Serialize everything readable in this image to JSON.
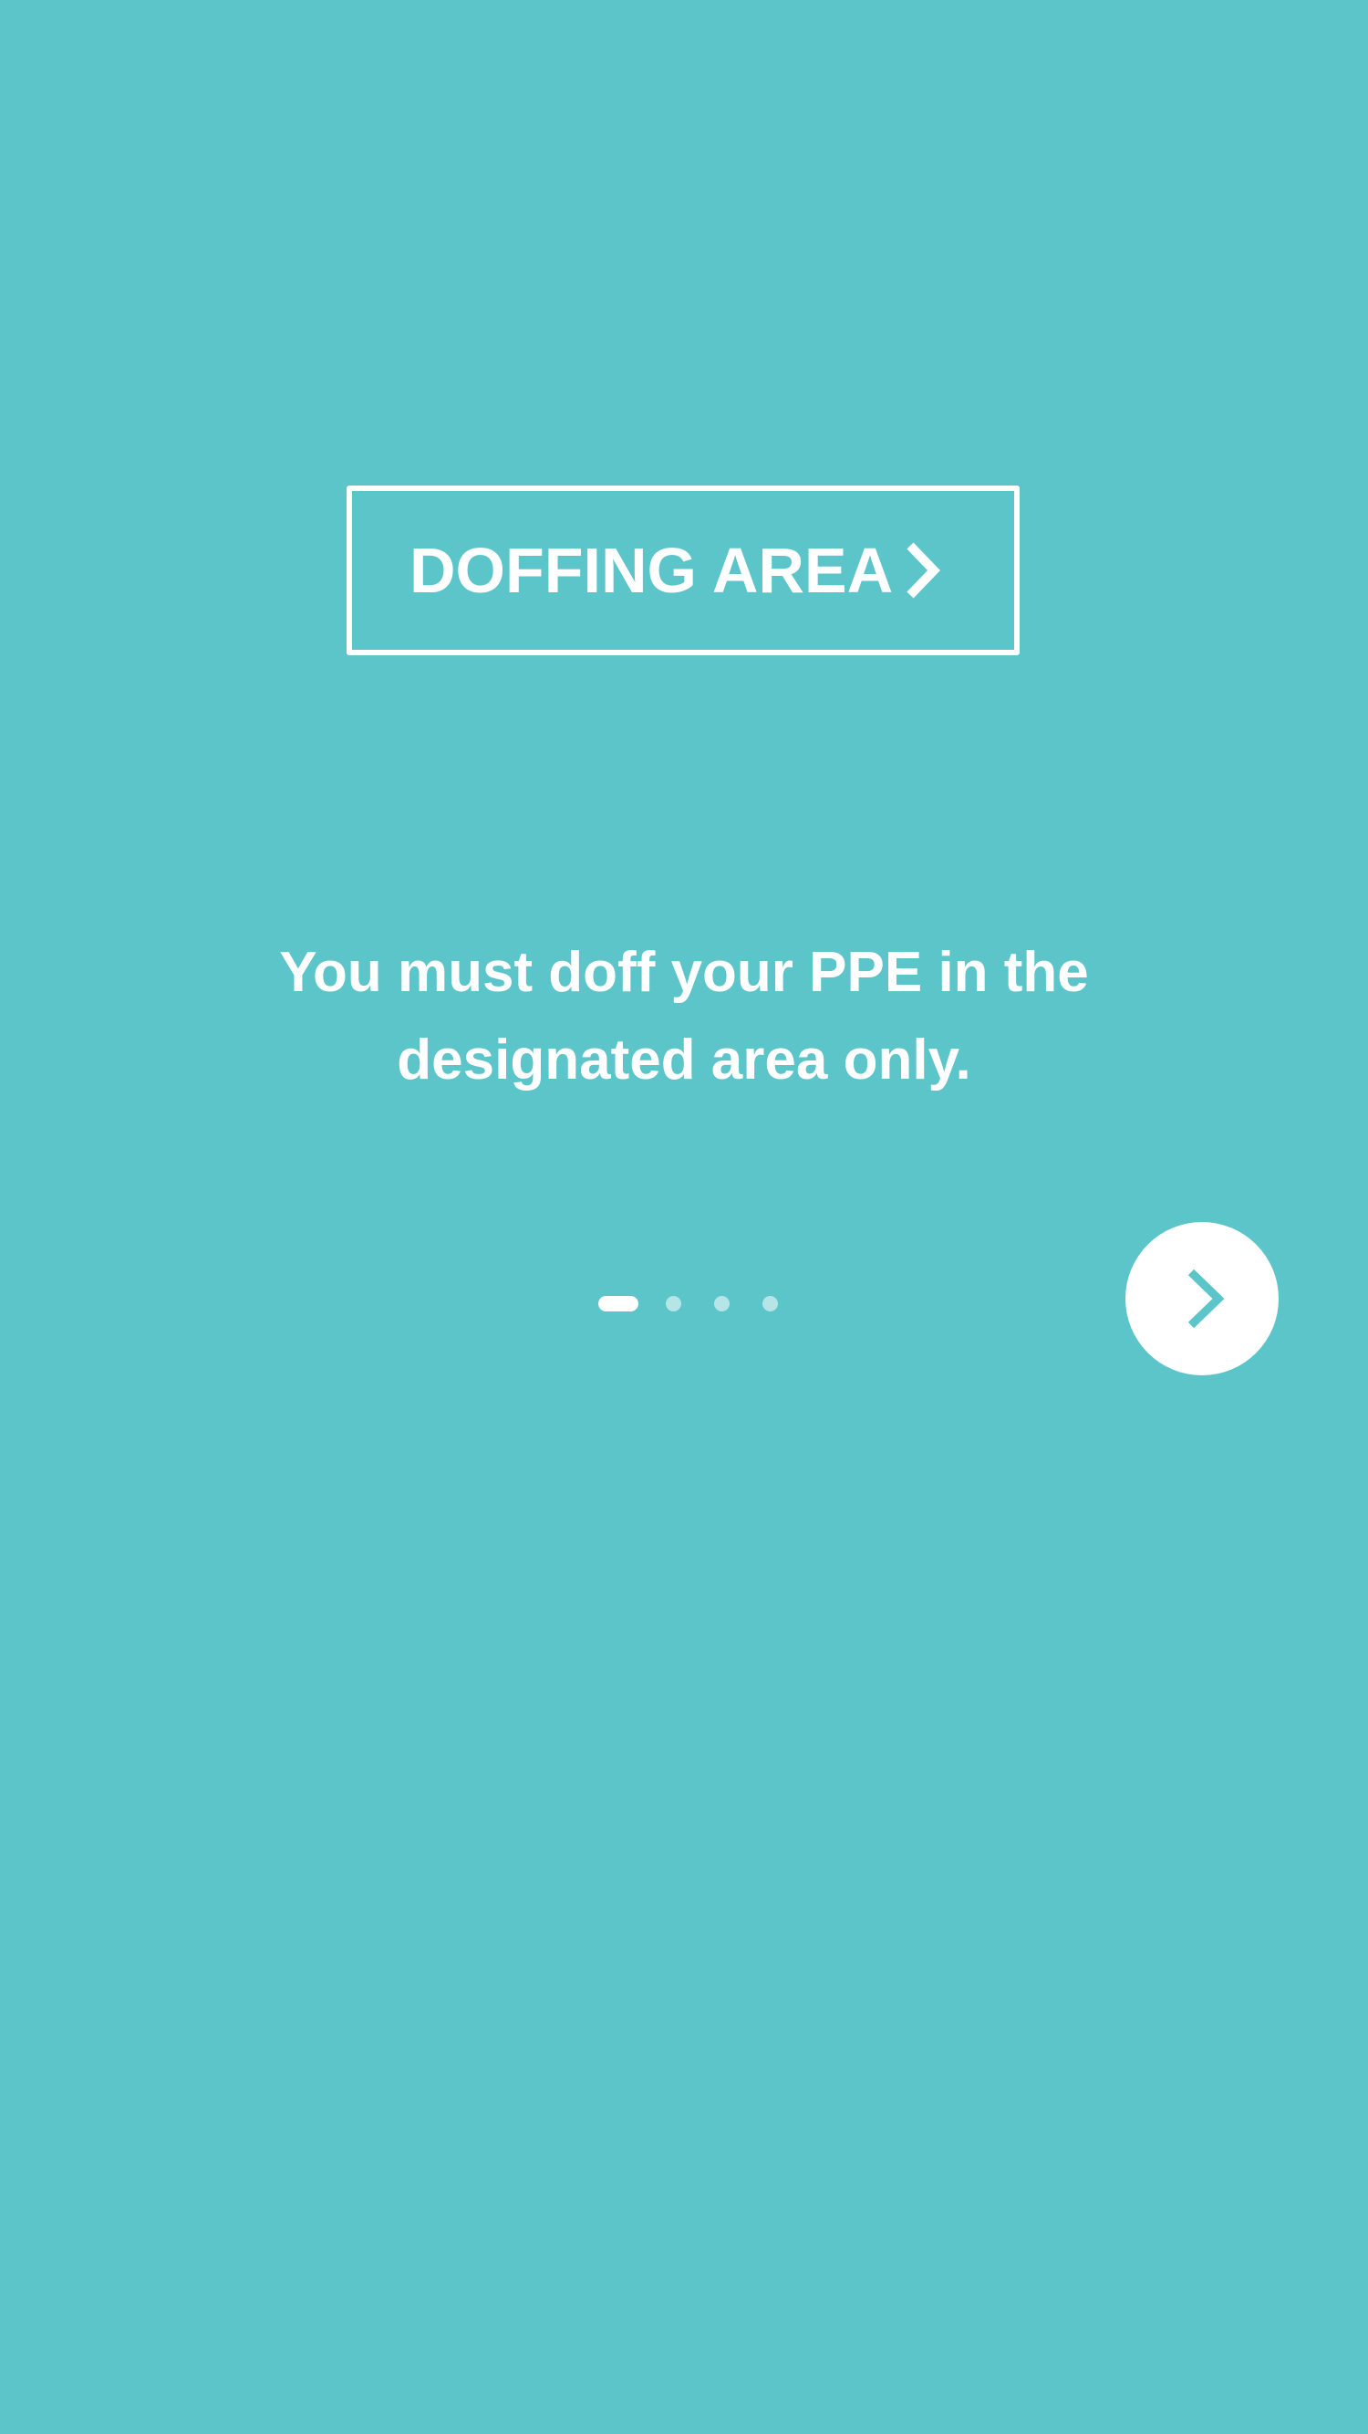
{
  "colors": {
    "background": "#5bc5ca",
    "foreground": "#ffffff"
  },
  "area_button": {
    "label": "DOFFING AREA",
    "icon": "chevron-right-icon"
  },
  "message": "You must doff your PPE in the designated area only.",
  "pager": {
    "total": 4,
    "current": 1
  },
  "next_button": {
    "icon": "chevron-right-icon"
  }
}
